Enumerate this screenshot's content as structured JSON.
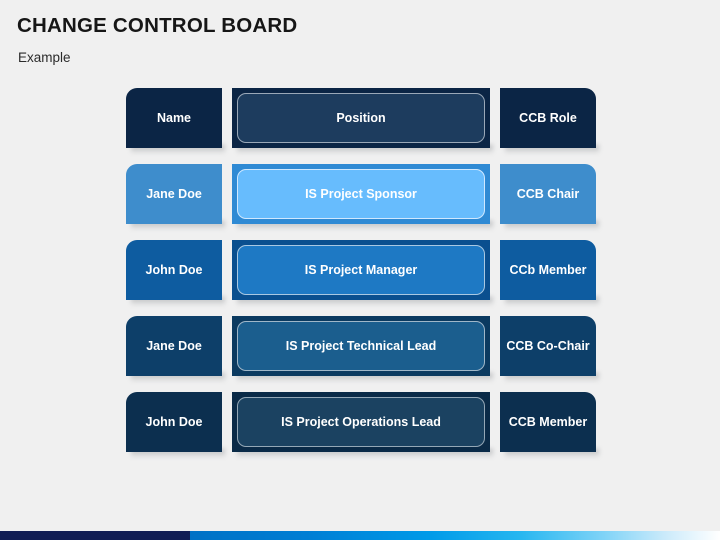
{
  "slide": {
    "title": "CHANGE CONTROL BOARD",
    "subtitle": "Example",
    "background_color": "#f0f0f0"
  },
  "table": {
    "columns": [
      "Name",
      "Position",
      "CCB Role"
    ],
    "header": {
      "name": "Name",
      "position": "Position",
      "role": "CCB Role",
      "color": "#0b2545"
    },
    "rows": [
      {
        "name": "Jane Doe",
        "position": "IS Project Sponsor",
        "role": "CCB Chair",
        "color": "#67bcfd",
        "accent": "#3e8dcc"
      },
      {
        "name": "John Doe",
        "position": "IS Project Manager",
        "role": "CCb Member",
        "color": "#1e79c4",
        "accent": "#0e5ca0"
      },
      {
        "name": "Jane Doe",
        "position": "IS Project Technical Lead",
        "role": "CCB Co-Chair",
        "color": "#1b5e8e",
        "accent": "#0d3f69"
      },
      {
        "name": "John Doe",
        "position": "IS Project Operations Lead",
        "role": "CCB Member",
        "color": "#1b4261",
        "accent": "#0c2f4f"
      }
    ]
  },
  "footer": {
    "navy_color": "#111d54",
    "gradient_start": "#0071c5",
    "gradient_end": "#ffffff"
  }
}
